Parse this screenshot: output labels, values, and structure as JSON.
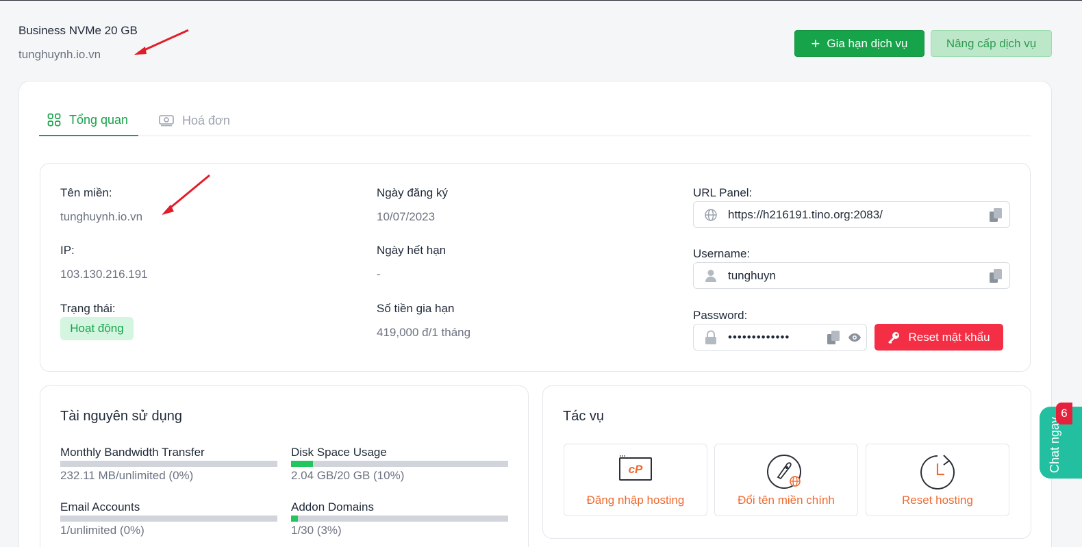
{
  "header": {
    "service_name": "Business NVMe 20 GB",
    "domain": "tunghuynh.io.vn",
    "renew_label": "Gia hạn dịch vụ",
    "upgrade_label": "Nâng cấp dịch vụ"
  },
  "tabs": [
    {
      "label": "Tổng quan",
      "icon": "grid-icon",
      "active": true
    },
    {
      "label": "Hoá đơn",
      "icon": "money-icon",
      "active": false
    }
  ],
  "info": {
    "domain_label": "Tên miền:",
    "domain_value": "tunghuynh.io.vn",
    "ip_label": "IP:",
    "ip_value": "103.130.216.191",
    "status_label": "Trạng thái:",
    "status_value": "Hoạt động",
    "reg_date_label": "Ngày đăng ký",
    "reg_date_value": "10/07/2023",
    "exp_date_label": "Ngày hết hạn",
    "exp_date_value": "-",
    "renew_price_label": "Số tiền gia hạn",
    "renew_price_value": "419,000 đ/1 tháng",
    "url_panel_label": "URL Panel:",
    "url_panel_value": "https://h216191.tino.org:2083/",
    "username_label": "Username:",
    "username_value": "tunghuyn",
    "password_label": "Password:",
    "password_value": "•••••••••••••",
    "reset_password_label": "Reset mật khẩu"
  },
  "resources": {
    "title": "Tài nguyên sử dụng",
    "items": [
      {
        "label": "Monthly Bandwidth Transfer",
        "value": "232.11 MB/unlimited (0%)",
        "fraction": 0.0
      },
      {
        "label": "Disk Space Usage",
        "value": "2.04 GB/20 GB (10%)",
        "fraction": 0.1
      },
      {
        "label": "Email Accounts",
        "value": "1/unlimited (0%)",
        "fraction": 0.0
      },
      {
        "label": "Addon Domains",
        "value": "1/30 (3%)",
        "fraction": 0.03
      }
    ]
  },
  "tasks": {
    "title": "Tác vụ",
    "items": [
      {
        "label": "Đăng nhập hosting",
        "icon": "cpanel-icon"
      },
      {
        "label": "Đổi tên miền chính",
        "icon": "rocket-globe-icon"
      },
      {
        "label": "Reset hosting",
        "icon": "clock-reset-icon"
      }
    ]
  },
  "chat": {
    "label": "Chat ngay",
    "badge": "6"
  },
  "colors": {
    "primary_green": "#16a34a",
    "danger_red": "#f42e44",
    "task_orange": "#ee6a2f",
    "chat_teal": "#22c0a0",
    "arrow_red": "#e11d2a"
  }
}
